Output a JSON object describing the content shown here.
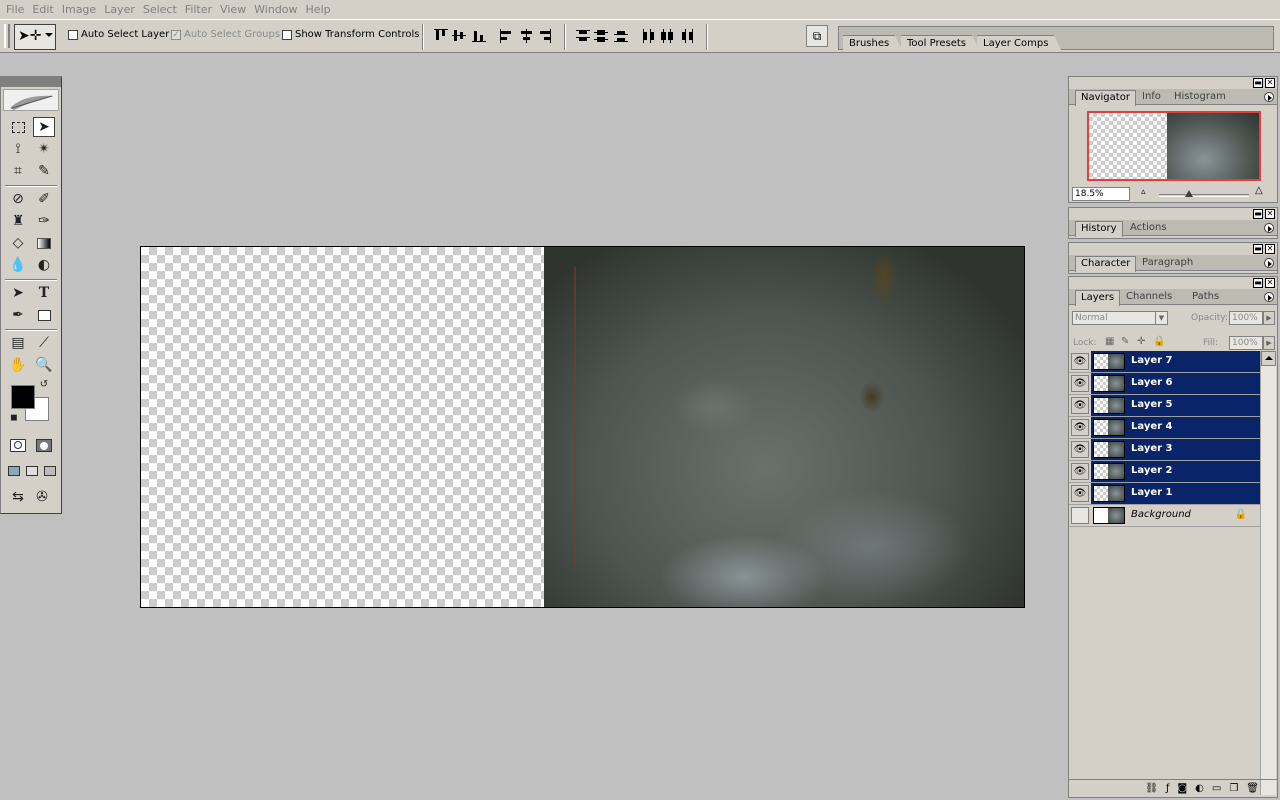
{
  "menu": [
    "File",
    "Edit",
    "Image",
    "Layer",
    "Select",
    "Filter",
    "View",
    "Window",
    "Help"
  ],
  "options": {
    "auto_select_layer": "Auto Select Layer",
    "auto_select_groups": "Auto Select Groups",
    "show_transform_controls": "Show Transform Controls"
  },
  "palette_well": {
    "tabs": [
      "Brushes",
      "Tool Presets",
      "Layer Comps"
    ]
  },
  "navigator": {
    "tabs": [
      "Navigator",
      "Info",
      "Histogram"
    ],
    "zoom": "18.5%"
  },
  "history": {
    "tabs": [
      "History",
      "Actions"
    ]
  },
  "character": {
    "tabs": [
      "Character",
      "Paragraph"
    ]
  },
  "layers_panel": {
    "tabs": [
      "Layers",
      "Channels",
      "Paths"
    ],
    "blend_mode": "Normal",
    "opacity_label": "Opacity:",
    "opacity": "100%",
    "lock_label": "Lock:",
    "fill_label": "Fill:",
    "fill": "100%",
    "layers": [
      {
        "name": "Layer 7",
        "selected": true
      },
      {
        "name": "Layer 6",
        "selected": true
      },
      {
        "name": "Layer 5",
        "selected": true
      },
      {
        "name": "Layer 4",
        "selected": true
      },
      {
        "name": "Layer 3",
        "selected": true
      },
      {
        "name": "Layer 2",
        "selected": true
      },
      {
        "name": "Layer 1",
        "selected": true
      },
      {
        "name": "Background",
        "selected": false
      }
    ]
  },
  "colors": {
    "selection": "#0a246a",
    "foreground": "#000000",
    "background": "#ffffff"
  }
}
